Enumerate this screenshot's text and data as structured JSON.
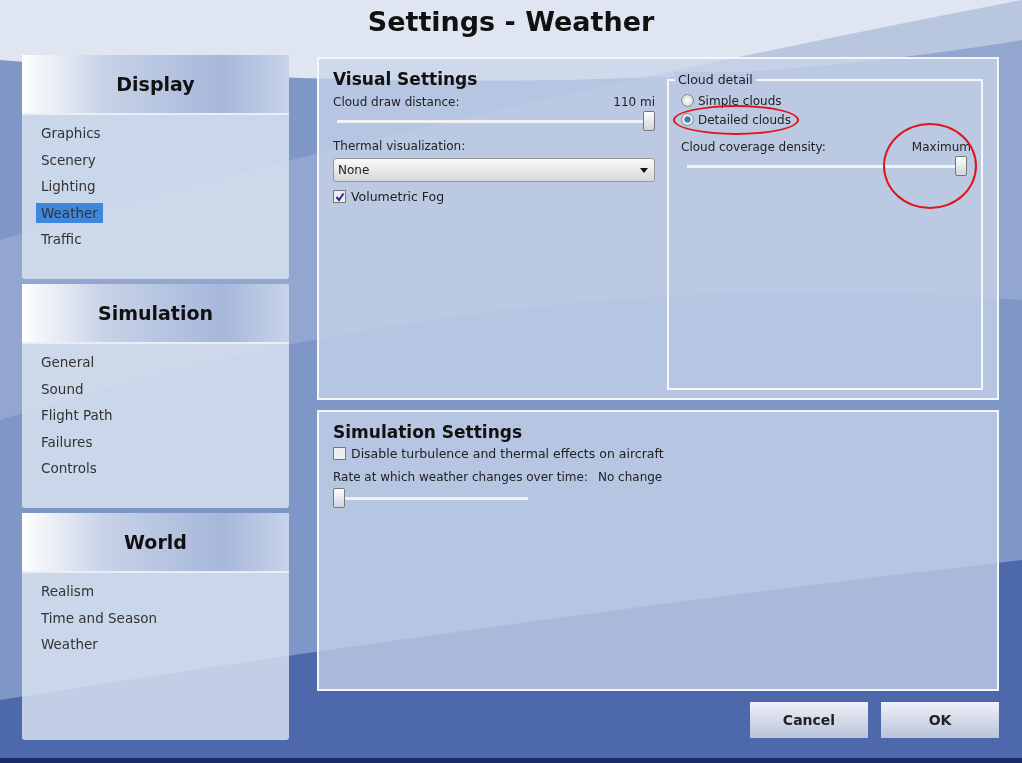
{
  "window": {
    "title": "Settings - Weather"
  },
  "sidebar": [
    {
      "heading": "Display",
      "items": [
        {
          "label": "Graphics",
          "selected": false
        },
        {
          "label": "Scenery",
          "selected": false
        },
        {
          "label": "Lighting",
          "selected": false
        },
        {
          "label": "Weather",
          "selected": true
        },
        {
          "label": "Traffic",
          "selected": false
        }
      ]
    },
    {
      "heading": "Simulation",
      "items": [
        {
          "label": "General",
          "selected": false
        },
        {
          "label": "Sound",
          "selected": false
        },
        {
          "label": "Flight Path",
          "selected": false
        },
        {
          "label": "Failures",
          "selected": false
        },
        {
          "label": "Controls",
          "selected": false
        }
      ]
    },
    {
      "heading": "World",
      "items": [
        {
          "label": "Realism",
          "selected": false
        },
        {
          "label": "Time and Season",
          "selected": false
        },
        {
          "label": "Weather",
          "selected": false
        }
      ]
    }
  ],
  "visual_settings": {
    "title": "Visual Settings",
    "cloud_draw_distance": {
      "label": "Cloud draw distance:",
      "reading": "110 mi",
      "level": 1.0
    },
    "thermal_visualization": {
      "label": "Thermal visualization:",
      "value": "None"
    },
    "volumetric_fog": {
      "label": "Volumetric Fog",
      "checked": true
    },
    "cloud_detail": {
      "title": "Cloud detail",
      "options": [
        {
          "label": "Simple clouds",
          "selected": false,
          "circled": false
        },
        {
          "label": "Detailed clouds",
          "selected": true,
          "circled": true
        }
      ],
      "coverage": {
        "label": "Cloud coverage density:",
        "reading": "Maximum",
        "level": 1.0,
        "circled": true
      }
    }
  },
  "simulation_settings": {
    "title": "Simulation Settings",
    "disable_turbulence": {
      "label": "Disable turbulence and thermal effects on aircraft",
      "checked": false
    },
    "weather_rate": {
      "label": "Rate at which weather changes over time:",
      "reading": "No change",
      "level": 0.0
    }
  },
  "buttons": [
    "Cancel",
    "OK"
  ]
}
